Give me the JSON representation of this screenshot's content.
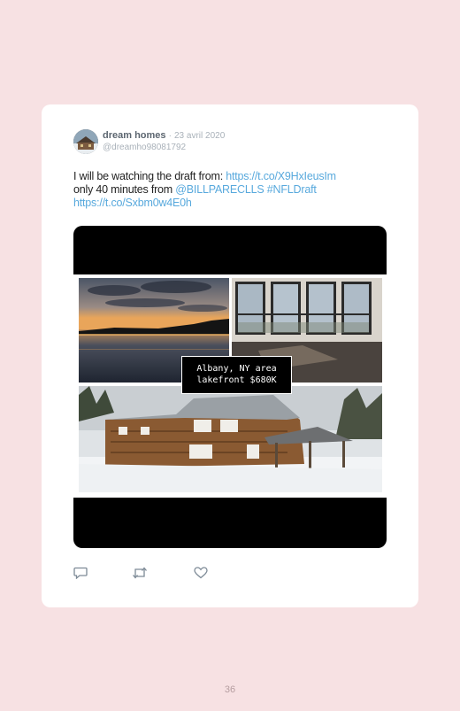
{
  "tweet": {
    "author_name": "dream homes",
    "separator": "·",
    "date": "23 avril 2020",
    "handle": "@dreamho98081792",
    "text": {
      "line1_prefix": "I will be watching the draft from: ",
      "link1": "https://t.co/X9HxIeusIm",
      "line2_prefix": "only 40 minutes from ",
      "mention": "@BILLPARECLLS",
      "hashtag": "#NFLDraft",
      "link2": "https://t.co/Sxbm0w4E0h"
    },
    "media": {
      "caption_line1": "Albany, NY area",
      "caption_line2": "lakefront $680K",
      "photos": [
        "lake-sunset",
        "empty-room-windows",
        "log-house-snow"
      ]
    },
    "actions": [
      "reply-icon",
      "retweet-icon",
      "like-icon"
    ]
  },
  "page": {
    "number": "36"
  },
  "colors": {
    "background": "#f7e1e3",
    "card": "#ffffff",
    "link": "#58a9dd",
    "muted": "#a9b1b9"
  }
}
